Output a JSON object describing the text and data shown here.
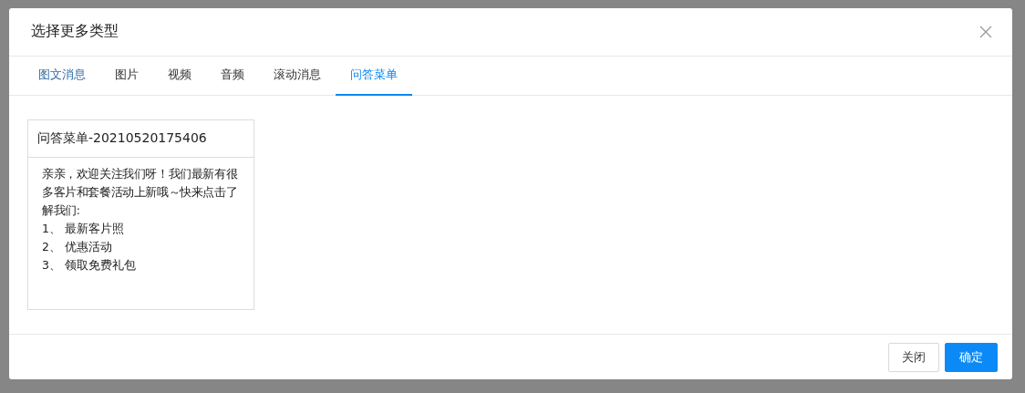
{
  "dialog": {
    "title": "选择更多类型",
    "tabs": [
      {
        "label": "图文消息",
        "selected": false,
        "hovered": true
      },
      {
        "label": "图片",
        "selected": false,
        "hovered": false
      },
      {
        "label": "视频",
        "selected": false,
        "hovered": false
      },
      {
        "label": "音频",
        "selected": false,
        "hovered": false
      },
      {
        "label": "滚动消息",
        "selected": false,
        "hovered": false
      },
      {
        "label": "问答菜单",
        "selected": true,
        "hovered": false
      }
    ],
    "cards": [
      {
        "title": "问答菜单-20210520175406",
        "paragraph": "亲亲，欢迎关注我们呀！我们最新有很多客片和套餐活动上新哦～快来点击了解我们:",
        "items": [
          "1、 最新客片照",
          "2、 优惠活动",
          "3、 领取免费礼包"
        ]
      }
    ],
    "buttons": [
      {
        "label": "关闭",
        "kind": "default"
      },
      {
        "label": "确定",
        "kind": "primary"
      }
    ]
  }
}
